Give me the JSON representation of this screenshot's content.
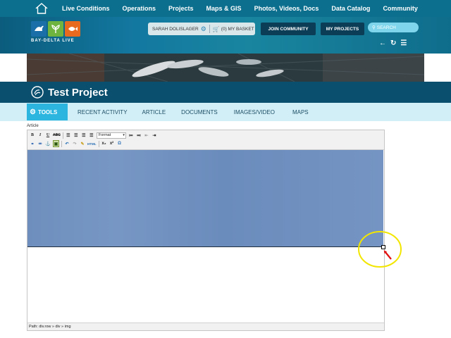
{
  "nav": {
    "items": [
      "Live Conditions",
      "Operations",
      "Projects",
      "Maps & GIS",
      "Photos, Videos, Docs",
      "Data Catalog",
      "Community"
    ]
  },
  "header": {
    "logo_text": "BAY-DELTA LIVE",
    "user_name": "SARAH DOLISLAGER",
    "basket_label": "(0) MY BASKET",
    "join_label": "JOIN COMMUNITY",
    "my_projects_label": "MY PROJECTS",
    "search_placeholder": "SEARCH"
  },
  "project": {
    "title": "Test Project"
  },
  "tabs": {
    "tools": "TOOLS",
    "items": [
      "RECENT ACTIVITY",
      "ARTICLE",
      "DOCUMENTS",
      "IMAGES/VIDEO",
      "MAPS"
    ]
  },
  "editor": {
    "label": "Article",
    "format_label": "Format",
    "path": "Path: div.row » div » img"
  },
  "colors": {
    "nav_bg": "#0d6f8e",
    "title_bg": "#0b4f6e",
    "tab_active": "#2cb5df",
    "annotation": "#f2e600",
    "arrow": "#e01010"
  }
}
